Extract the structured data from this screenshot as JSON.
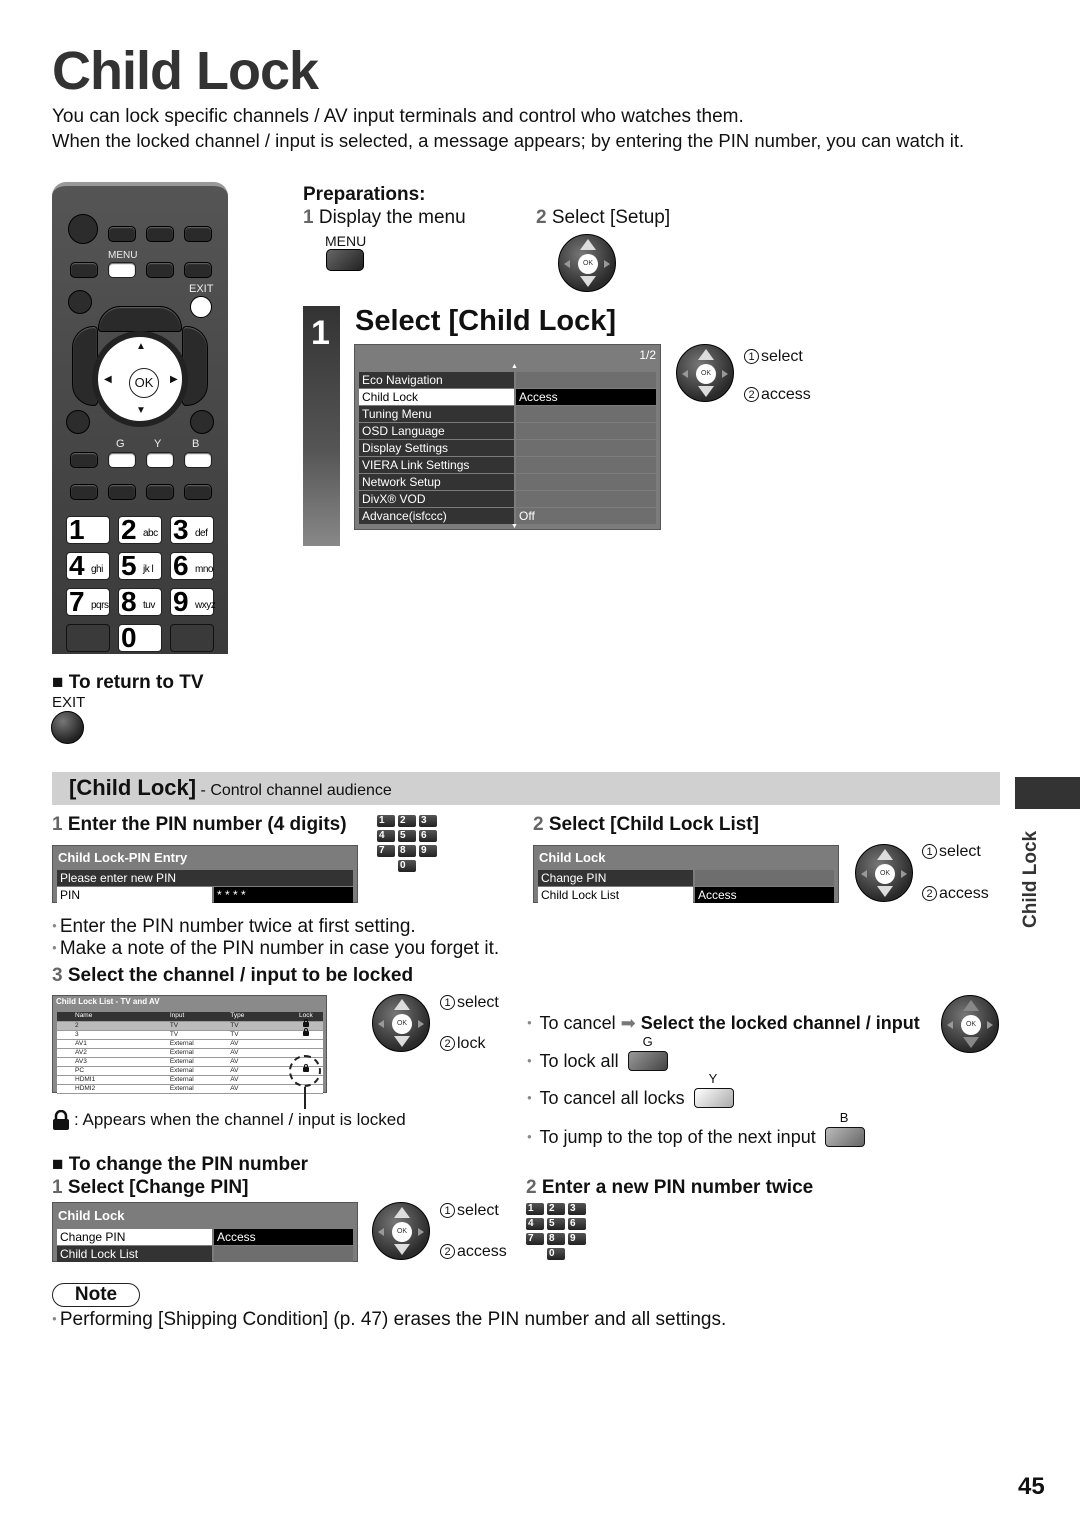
{
  "page": {
    "title": "Child Lock",
    "intro_line1": "You can lock specific channels / AV input terminals and control who watches them.",
    "intro_line2": "When the locked channel / input is selected, a message appears; by entering the PIN number, you can watch it.",
    "page_number": "45",
    "side_tab_label": "Child Lock"
  },
  "remote": {
    "menu_label": "MENU",
    "exit_label": "EXIT",
    "ok_label": "OK",
    "color_labels": [
      "G",
      "Y",
      "B"
    ],
    "number_keys": [
      {
        "digit": "1",
        "letters": ""
      },
      {
        "digit": "2",
        "letters": "abc"
      },
      {
        "digit": "3",
        "letters": "def"
      },
      {
        "digit": "4",
        "letters": "ghi"
      },
      {
        "digit": "5",
        "letters": "jk l"
      },
      {
        "digit": "6",
        "letters": "mno"
      },
      {
        "digit": "7",
        "letters": "pqrs"
      },
      {
        "digit": "8",
        "letters": "tuv"
      },
      {
        "digit": "9",
        "letters": "wxyz"
      },
      {
        "digit": "0",
        "letters": ""
      }
    ]
  },
  "preparations": {
    "heading": "Preparations:",
    "step1_num": "1",
    "step1_text": "Display the menu",
    "step1_button": "MENU",
    "step2_num": "2",
    "step2_text": "Select [Setup]"
  },
  "step1": {
    "number": "1",
    "heading": "Select [Child Lock]",
    "osd_page": "1/2",
    "menu_items": [
      {
        "label": "Eco Navigation",
        "value": "",
        "selected": false
      },
      {
        "label": "Child Lock",
        "value": "Access",
        "selected": true
      },
      {
        "label": "Tuning Menu",
        "value": "",
        "selected": false
      },
      {
        "label": "OSD Language",
        "value": "",
        "selected": false
      },
      {
        "label": "Display Settings",
        "value": "",
        "selected": false
      },
      {
        "label": "VIERA Link Settings",
        "value": "",
        "selected": false
      },
      {
        "label": "Network Setup",
        "value": "",
        "selected": false
      },
      {
        "label": "DivX® VOD",
        "value": "",
        "selected": false
      },
      {
        "label": "Advance(isfccc)",
        "value": "Off",
        "selected": false
      }
    ],
    "annot_select": "select",
    "annot_access": "access"
  },
  "return_tv": {
    "heading": "■ To return to TV",
    "button_label": "EXIT"
  },
  "section": {
    "title": "[Child Lock]",
    "subtitle": " - Control channel audience"
  },
  "pin_entry": {
    "step_num": "1",
    "heading": "Enter the PIN number (4 digits)",
    "osd_title": "Child Lock-PIN Entry",
    "prompt": "Please enter new PIN",
    "field_label": "PIN",
    "field_value": "*  *  *  *",
    "bullets": [
      "Enter the PIN number twice at first setting.",
      "Make a note of the PIN number in case you forget it."
    ]
  },
  "select_list": {
    "step_num": "2",
    "heading": "Select [Child Lock List]",
    "osd_title": "Child Lock",
    "items": [
      {
        "label": "Change PIN",
        "value": "",
        "selected": false
      },
      {
        "label": "Child Lock List",
        "value": "Access",
        "selected": true
      }
    ],
    "annot_select": "select",
    "annot_access": "access"
  },
  "lock_channels": {
    "step_num": "3",
    "heading": "Select the channel / input to be locked",
    "table_title": "Child Lock List - TV and AV",
    "columns": [
      "Name",
      "Input",
      "Type",
      "Lock"
    ],
    "rows": [
      {
        "name": "2",
        "input": "TV",
        "type": "TV",
        "locked": true,
        "highlight": true
      },
      {
        "name": "3",
        "input": "TV",
        "type": "TV",
        "locked": true,
        "highlight": false
      },
      {
        "name": "AV1",
        "input": "External",
        "type": "AV",
        "locked": false,
        "highlight": false
      },
      {
        "name": "AV2",
        "input": "External",
        "type": "AV",
        "locked": false,
        "highlight": false
      },
      {
        "name": "AV3",
        "input": "External",
        "type": "AV",
        "locked": false,
        "highlight": false
      },
      {
        "name": "PC",
        "input": "External",
        "type": "AV",
        "locked": true,
        "highlight": false
      },
      {
        "name": "HDMI1",
        "input": "External",
        "type": "AV",
        "locked": false,
        "highlight": false
      },
      {
        "name": "HDMI2",
        "input": "External",
        "type": "AV",
        "locked": false,
        "highlight": false
      }
    ],
    "annot_select": "select",
    "annot_lock": "lock",
    "lock_legend": ": Appears when the channel / input is locked",
    "tips": {
      "cancel_prefix": "To cancel",
      "cancel_action": "Select the locked channel / input",
      "lock_all": "To lock all",
      "lock_all_key": "G",
      "cancel_all": "To cancel all locks",
      "cancel_all_key": "Y",
      "jump_next": "To jump to the top of the next input",
      "jump_next_key": "B"
    }
  },
  "change_pin": {
    "heading": "■ To change the PIN number",
    "step1_num": "1",
    "step1_heading": "Select [Change PIN]",
    "osd_title": "Child Lock",
    "items": [
      {
        "label": "Change PIN",
        "value": "Access",
        "selected": true
      },
      {
        "label": "Child Lock List",
        "value": "",
        "selected": false
      }
    ],
    "annot_select": "select",
    "annot_access": "access",
    "step2_num": "2",
    "step2_heading": "Enter a new PIN number twice"
  },
  "note": {
    "label": "Note",
    "text": "Performing [Shipping Condition] (p. 47) erases the PIN number and all settings."
  },
  "colors": {
    "title_gray": "#333333",
    "section_bar": "#d0d0d0",
    "osd_bg": "#7c7c7c",
    "osd_dark_row": "#333333",
    "selected_value": "#000000"
  }
}
